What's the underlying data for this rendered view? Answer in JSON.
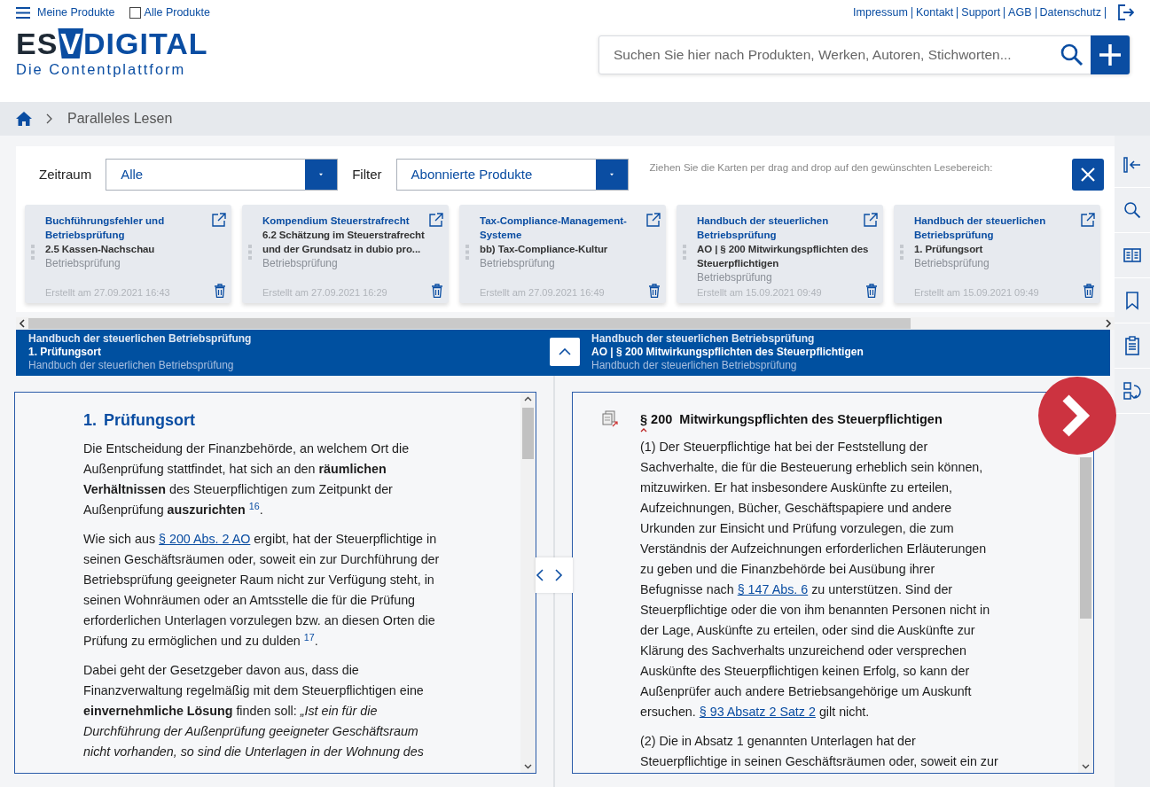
{
  "top_nav": {
    "menu": "Meine Produkte",
    "all_products": {
      "label": "Alle Produkte",
      "checked": false
    },
    "links": [
      "Impressum",
      "Kontakt",
      "Support",
      "AGB",
      "Datenschutz"
    ]
  },
  "logo": {
    "left": "ES",
    "mark": "V",
    "right": "DIGITAL",
    "tagline": "Die Contentplattform"
  },
  "search": {
    "placeholder": "Suchen Sie hier nach Produkten, Werken, Autoren, Stichworten..."
  },
  "breadcrumb": [
    "Paralleles Lesen"
  ],
  "filters": [
    {
      "label": "Zeitraum",
      "value": "Alle"
    },
    {
      "label": "Filter",
      "value": "Abonnierte Produkte"
    }
  ],
  "hint": "Ziehen Sie die Karten per drag and drop auf den gewünschten Lesebereich:",
  "cards": [
    {
      "title": "Buchführungsfehler und Betriebsprüfung",
      "section": "2.5 Kassen-Nachschau",
      "category": "Betriebsprüfung",
      "created": "Erstellt am 27.09.2021 16:43"
    },
    {
      "title": "Kompendium Steuerstrafrecht",
      "section": "6.2 Schätzung im Steuerstrafrecht und der Grundsatz in dubio pro...",
      "category": "Betriebsprüfung",
      "created": "Erstellt am 27.09.2021 16:29"
    },
    {
      "title": "Tax-Compliance-Management-Systeme",
      "section": "bb) Tax-Compliance-Kultur",
      "category": "Betriebsprüfung",
      "created": "Erstellt am 27.09.2021 16:49"
    },
    {
      "title": "Handbuch der steuerlichen Betriebsprüfung",
      "section": "AO | § 200 Mitwirkungspflichten des Steuerpflichtigen",
      "category": "Betriebsprüfung",
      "created": "Erstellt am 15.09.2021 09:49"
    },
    {
      "title": "Handbuch der steuerlichen Betriebsprüfung",
      "section": "1. Prüfungsort",
      "category": "Betriebsprüfung",
      "created": "Erstellt am 15.09.2021 09:49"
    }
  ],
  "reading_bar": [
    {
      "work": "Handbuch der steuerlichen Betriebsprüfung",
      "section": "1. Prüfungsort",
      "subtitle": "Handbuch der steuerlichen Betriebsprüfung"
    },
    {
      "work": "Handbuch der steuerlichen Betriebsprüfung",
      "section": "AO | § 200 Mitwirkungspflichten des Steuerpflichtigen",
      "subtitle": "Handbuch der steuerlichen Betriebsprüfung"
    }
  ],
  "left_pane": {
    "number": "1.",
    "heading": "Prüfungsort",
    "paragraphs": [
      [
        {
          "kind": "text",
          "text": "Die Entscheidung der Finanzbehörde, an welchem Ort die Außenprüfung stattfindet, hat sich an den **räumlichen Verhältnissen** des Steuerpflichtigen zum Zeitpunkt der Außenprüfung **auszurichten** $^{16}$."
        }
      ],
      [
        {
          "kind": "text",
          "text": "Wie sich aus "
        },
        {
          "kind": "link",
          "text": "§ 200 Abs. 2 AO"
        },
        {
          "kind": "text",
          "text": " ergibt, hat der Steuerpflichtige in seinen Geschäftsräumen oder, soweit ein zur Durchführung der Betriebsprüfung geeigneter Raum nicht zur Verfügung steht, in seinen Wohnräumen oder an Amtsstelle die für die Prüfung erforderlichen Unterlagen vorzulegen bzw. an diesen Orten die Prüfung zu ermöglichen und zu dulden $^{17}$."
        }
      ],
      [
        {
          "kind": "text",
          "text": "Dabei geht der Gesetzgeber davon aus, dass die Finanzverwaltung regelmäßig mit dem Steuerpflichtigen eine **einvernehmliche Lösung** finden soll: *„Ist ein für die Durchführung der Außenprüfung geeigneter Geschäftsraum nicht vorhanden, so sind die Unterlagen in der Wohnung des*"
        }
      ]
    ]
  },
  "right_pane": {
    "number": "§ 200",
    "heading": "Mitwirkungspflichten des Steuerpflichtigen",
    "paragraphs": [
      [
        {
          "kind": "text",
          "text": "(1)  Der Steuerpflichtige hat bei der Feststellung der Sachverhalte, die für die Besteuerung erheblich sein können, mitzuwirken. Er hat insbesondere Auskünfte zu erteilen, Aufzeichnungen, Bücher, Geschäftspapiere und andere Urkunden zur Einsicht und Prüfung vorzulegen, die zum Verständnis der Aufzeichnungen erforderlichen Erläuterungen zu geben und die Finanzbehörde bei Ausübung ihrer Befugnisse nach "
        },
        {
          "kind": "link",
          "text": "§ 147 Abs. 6"
        },
        {
          "kind": "text",
          "text": " zu unterstützen. Sind der Steuerpflichtige oder die von ihm benannten Personen nicht in der Lage, Auskünfte zu erteilen, oder sind die Auskünfte zur Klärung des Sachverhalts unzureichend oder versprechen Auskünfte des Steuerpflichtigen keinen Erfolg, so kann der Außenprüfer auch andere Betriebsangehörige um Auskunft ersuchen. "
        },
        {
          "kind": "link",
          "text": "§ 93 Absatz 2 Satz 2"
        },
        {
          "kind": "text",
          "text": " gilt nicht."
        }
      ],
      [
        {
          "kind": "text",
          "text": "(2)  Die in Absatz 1 genannten Unterlagen hat der Steuerpflichtige in seinen Geschäftsräumen oder, soweit ein zur"
        }
      ]
    ]
  }
}
